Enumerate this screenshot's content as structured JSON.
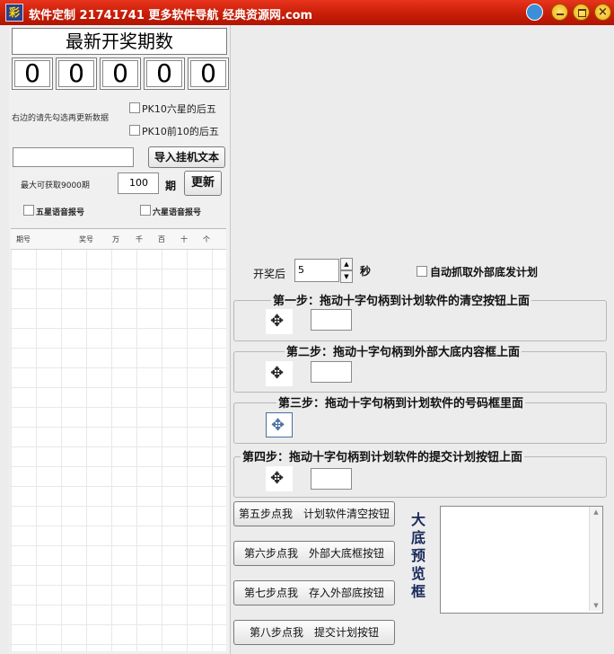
{
  "window": {
    "title": "软件定制 21741741 更多软件导航 经典资源网.com",
    "app_icon_glyph": "彩"
  },
  "left": {
    "issue_title": "最新开奖期数",
    "digits": [
      "0",
      "0",
      "0",
      "0",
      "0"
    ],
    "hint": "右边的请先勾选再更新数据",
    "checkboxes": {
      "pk10_six_star": "PK10六星的后五",
      "pk10_top10": "PK10前10的后五",
      "five_star_voice": "五星语音报号",
      "six_star_voice": "六星语音报号"
    },
    "import_button": "导入挂机文本",
    "max_fetch_label": "最大可获取9000期",
    "period_value": "100",
    "period_unit": "期",
    "update_button": "更新",
    "grid_headers": [
      "期号",
      "奖号",
      "万",
      "千",
      "百",
      "十",
      "个"
    ]
  },
  "right": {
    "after_draw_label": "开奖后",
    "seconds_value": "5",
    "seconds_unit": "秒",
    "auto_capture_label": "自动抓取外部底发计划",
    "steps": [
      "第一步：拖动十字句柄到计划软件的清空按钮上面",
      "第二步：拖动十字句柄到外部大底内容框上面",
      "第三步：拖动十字句柄到计划软件的号码框里面",
      "第四步：拖动十字句柄到计划软件的提交计划按钮上面"
    ],
    "cross_glyph": "✥",
    "buttons": [
      "第五步点我　计划软件清空按钮",
      "第六步点我　外部大底框按钮",
      "第七步点我　存入外部底按钮",
      "第八步点我　提交计划按钮"
    ],
    "preview_label_chars": [
      "大",
      "底",
      "预",
      "览",
      "框"
    ]
  },
  "colors": {
    "titlebar": "#c81e08",
    "accent_text": "#1a2a5a"
  }
}
